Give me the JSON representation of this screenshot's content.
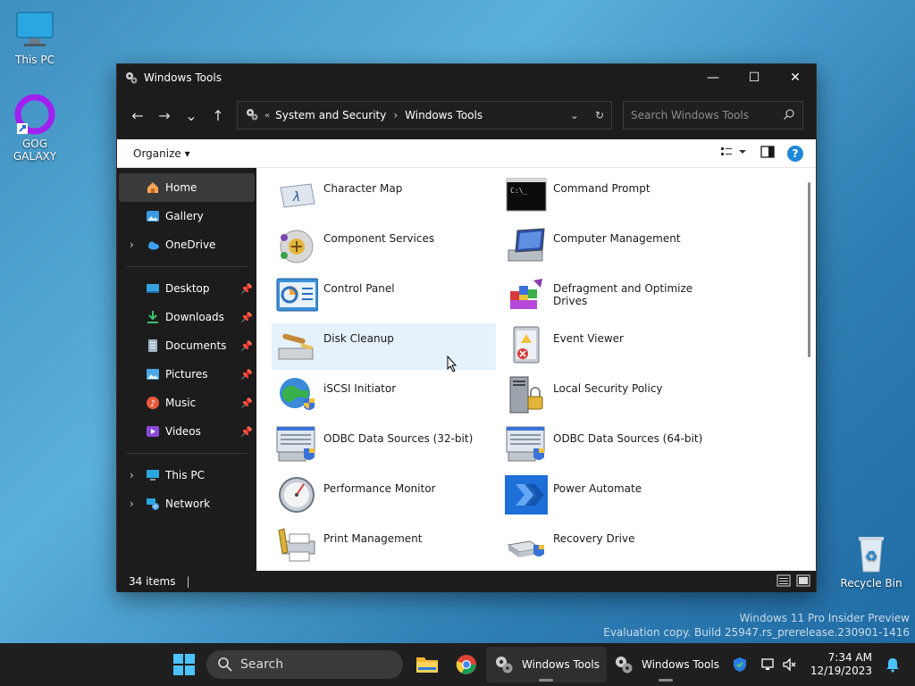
{
  "desktop": {
    "icons": [
      {
        "label": "This PC"
      },
      {
        "label": "GOG GALAXY"
      },
      {
        "label": "Recycle Bin"
      }
    ],
    "watermark_line1": "Windows 11 Pro Insider Preview",
    "watermark_line2": "Evaluation copy. Build 25947.rs_prerelease.230901-1416"
  },
  "window": {
    "title": "Windows Tools",
    "controls": {
      "minimize": "—",
      "maximize": "☐",
      "close": "✕"
    },
    "nav": {
      "back": "←",
      "forward": "→",
      "recent": "⌄",
      "up": "↑"
    },
    "address": {
      "overflow": "«",
      "crumb1": "System and Security",
      "separator": "›",
      "crumb2": "Windows Tools"
    },
    "search": {
      "placeholder": "Search Windows Tools"
    },
    "command_bar": {
      "organize": "Organize ▾"
    },
    "sidebar": {
      "home": "Home",
      "gallery": "Gallery",
      "onedrive": "OneDrive",
      "desktop": "Desktop",
      "downloads": "Downloads",
      "documents": "Documents",
      "pictures": "Pictures",
      "music": "Music",
      "videos": "Videos",
      "thispc": "This PC",
      "network": "Network"
    },
    "items": [
      "Character Map",
      "Command Prompt",
      "Component Services",
      "Computer Management",
      "Control Panel",
      "Defragment and Optimize Drives",
      "Disk Cleanup",
      "Event Viewer",
      "iSCSI Initiator",
      "Local Security Policy",
      "ODBC Data Sources (32-bit)",
      "ODBC Data Sources (64-bit)",
      "Performance Monitor",
      "Power Automate",
      "Print Management",
      "Recovery Drive"
    ],
    "status": {
      "count": "34 items",
      "cursor": "|"
    }
  },
  "taskbar": {
    "search": "Search",
    "app1": "Windows Tools",
    "app2": "Windows Tools",
    "time": "7:34 AM",
    "date": "12/19/2023"
  }
}
